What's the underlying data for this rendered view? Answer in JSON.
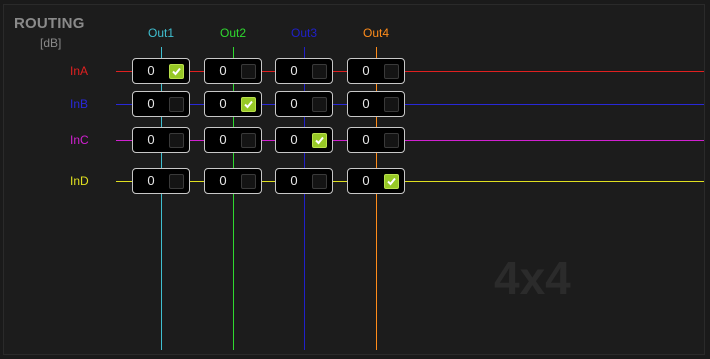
{
  "header": {
    "title": "ROUTING",
    "unit": "[dB]"
  },
  "outputs": [
    {
      "label": "Out1",
      "color": "#3fbfd0"
    },
    {
      "label": "Out2",
      "color": "#2fd92f"
    },
    {
      "label": "Out3",
      "color": "#2020c8"
    },
    {
      "label": "Out4",
      "color": "#ff8c1a"
    }
  ],
  "inputs": [
    {
      "label": "InA",
      "color": "#e02020"
    },
    {
      "label": "InB",
      "color": "#2828d8"
    },
    {
      "label": "InC",
      "color": "#d020d0"
    },
    {
      "label": "InD",
      "color": "#e0e020"
    }
  ],
  "matrix": [
    [
      {
        "value": "0",
        "checked": true
      },
      {
        "value": "0",
        "checked": false
      },
      {
        "value": "0",
        "checked": false
      },
      {
        "value": "0",
        "checked": false
      }
    ],
    [
      {
        "value": "0",
        "checked": false
      },
      {
        "value": "0",
        "checked": true
      },
      {
        "value": "0",
        "checked": false
      },
      {
        "value": "0",
        "checked": false
      }
    ],
    [
      {
        "value": "0",
        "checked": false
      },
      {
        "value": "0",
        "checked": false
      },
      {
        "value": "0",
        "checked": true
      },
      {
        "value": "0",
        "checked": false
      }
    ],
    [
      {
        "value": "0",
        "checked": false
      },
      {
        "value": "0",
        "checked": false
      },
      {
        "value": "0",
        "checked": false
      },
      {
        "value": "0",
        "checked": true
      }
    ]
  ],
  "watermark": "4x4"
}
